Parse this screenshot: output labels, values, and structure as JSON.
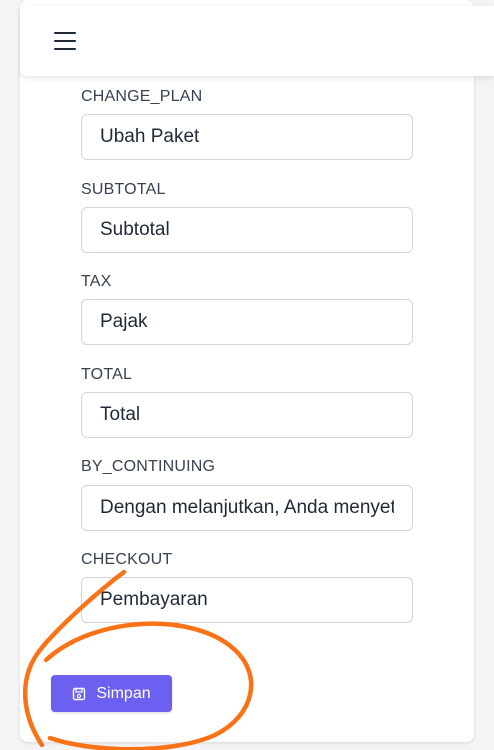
{
  "header": {
    "menu_icon": "hamburger-menu-icon"
  },
  "form": {
    "fields": [
      {
        "label": "CHANGE_PLAN",
        "value": "Ubah Paket"
      },
      {
        "label": "SUBTOTAL",
        "value": "Subtotal"
      },
      {
        "label": "TAX",
        "value": "Pajak"
      },
      {
        "label": "TOTAL",
        "value": "Total"
      },
      {
        "label": "BY_CONTINUING",
        "value": "Dengan melanjutkan, Anda menyetujui"
      },
      {
        "label": "CHECKOUT",
        "value": "Pembayaran"
      }
    ],
    "save_button": {
      "label": "Simpan",
      "icon": "save-icon"
    }
  },
  "colors": {
    "accent": "#6d5ff0",
    "annotation_stroke": "#f97316"
  }
}
